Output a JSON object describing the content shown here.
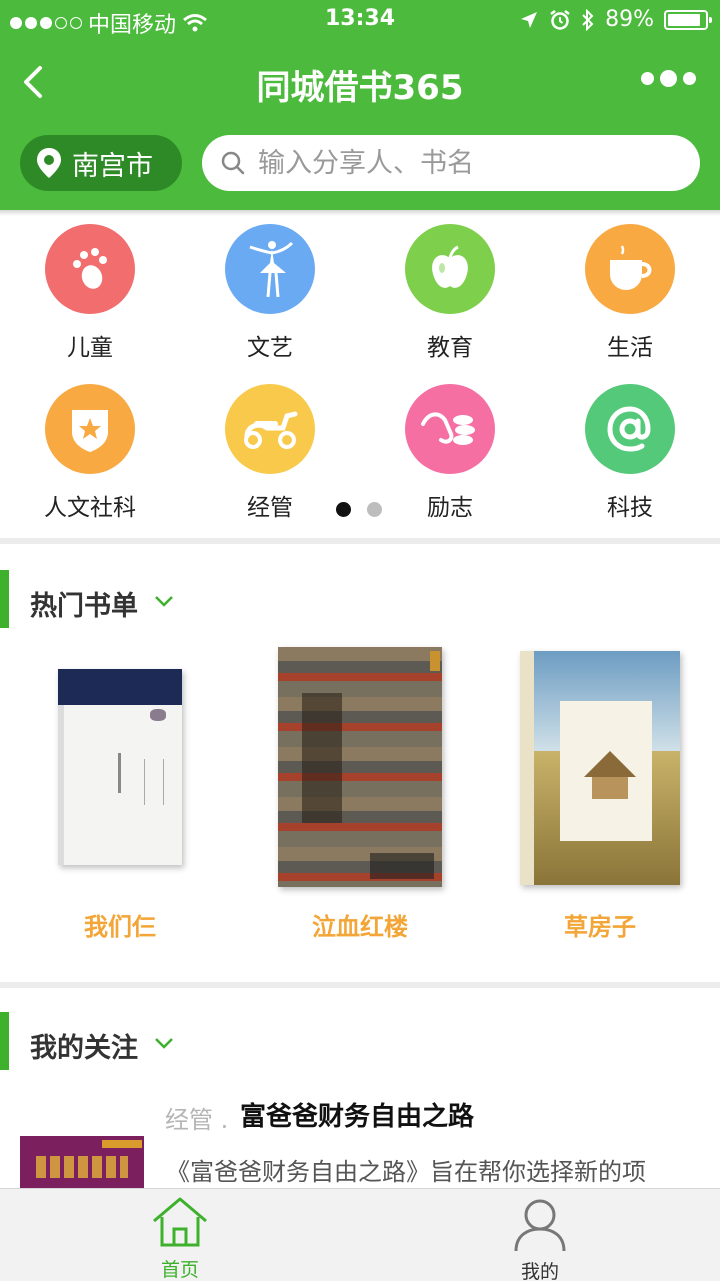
{
  "status_bar": {
    "carrier": "中国移动",
    "time": "13:34",
    "battery_percent": "89%",
    "battery_level": 0.89,
    "signal_bars_filled": 3,
    "signal_bars_total": 5
  },
  "nav": {
    "title": "同城借书365"
  },
  "search": {
    "city": "南宫市",
    "placeholder": "输入分享人、书名"
  },
  "categories": [
    {
      "label": "儿童",
      "color": "#f26d6d",
      "icon": "paw-icon"
    },
    {
      "label": "文艺",
      "color": "#6aaaf3",
      "icon": "dancer-icon"
    },
    {
      "label": "教育",
      "color": "#7ed04c",
      "icon": "apple-icon"
    },
    {
      "label": "生活",
      "color": "#f8a941",
      "icon": "cup-icon"
    },
    {
      "label": "人文社科",
      "color": "#f8a941",
      "icon": "shield-star-icon"
    },
    {
      "label": "经管",
      "color": "#f8c94a",
      "icon": "scooter-icon"
    },
    {
      "label": "励志",
      "color": "#f56fa3",
      "icon": "coins-icon"
    },
    {
      "label": "科技",
      "color": "#54c97a",
      "icon": "at-icon"
    }
  ],
  "pager": {
    "pages": 2,
    "active": 0
  },
  "hot_list": {
    "title": "热门书单",
    "books": [
      {
        "title": "我们仨"
      },
      {
        "title": "泣血红楼"
      },
      {
        "title": "草房子"
      }
    ]
  },
  "following": {
    "title": "我的关注",
    "items": [
      {
        "category": "经管 .",
        "title": "富爸爸财务自由之路",
        "description": "《富爸爸财务自由之路》旨在帮你选择新的项"
      }
    ]
  },
  "tabbar": {
    "home_label": "首页",
    "mine_label": "我的"
  },
  "colors": {
    "brand_green": "#4cba3c",
    "book_title_orange": "#f3a537"
  }
}
